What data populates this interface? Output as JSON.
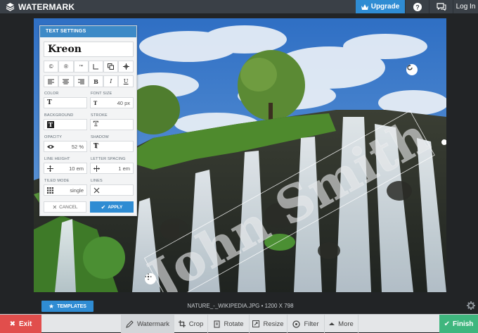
{
  "app": {
    "name": "WATERMARK"
  },
  "topbar": {
    "upgrade_label": "Upgrade",
    "login_label": "Log In"
  },
  "text_settings": {
    "title": "TEXT SETTINGS",
    "font": "Kreon",
    "symbols": [
      "©",
      "®",
      "™"
    ],
    "labels": {
      "color": "COLOR",
      "font_size": "FONT SIZE",
      "background": "BACKGROUND",
      "stroke": "STROKE",
      "opacity": "OPACITY",
      "shadow": "SHADOW",
      "line_height": "LINE HEIGHT",
      "letter_spacing": "LETTER SPACING",
      "tiled_mode": "TILED MODE",
      "lines": "LINES"
    },
    "values": {
      "font_size": "40 px",
      "opacity": "52 %",
      "line_height": "10 em",
      "letter_spacing": "1 em",
      "tiled_mode": "single"
    },
    "cancel_label": "CANCEL",
    "apply_label": "APPLY"
  },
  "watermark_text": "John Smith",
  "templates_label": "TEMPLATES",
  "file_info": "NATURE_-_WIKIPEDIA.JPG • 1200 X 798",
  "toolbar": {
    "exit_label": "Exit",
    "finish_label": "Finish",
    "tools": [
      {
        "label": "Watermark",
        "icon": "watermark-icon",
        "active": true
      },
      {
        "label": "Crop",
        "icon": "crop-icon"
      },
      {
        "label": "Rotate",
        "icon": "rotate-icon"
      },
      {
        "label": "Resize",
        "icon": "resize-icon"
      },
      {
        "label": "Filter",
        "icon": "filter-icon"
      },
      {
        "label": "More",
        "icon": "chevron-up-icon"
      }
    ]
  },
  "colors": {
    "accent": "#2f8cd3",
    "exit": "#e14e4c",
    "finish": "#3fb67e",
    "topbar": "#3a4047"
  }
}
